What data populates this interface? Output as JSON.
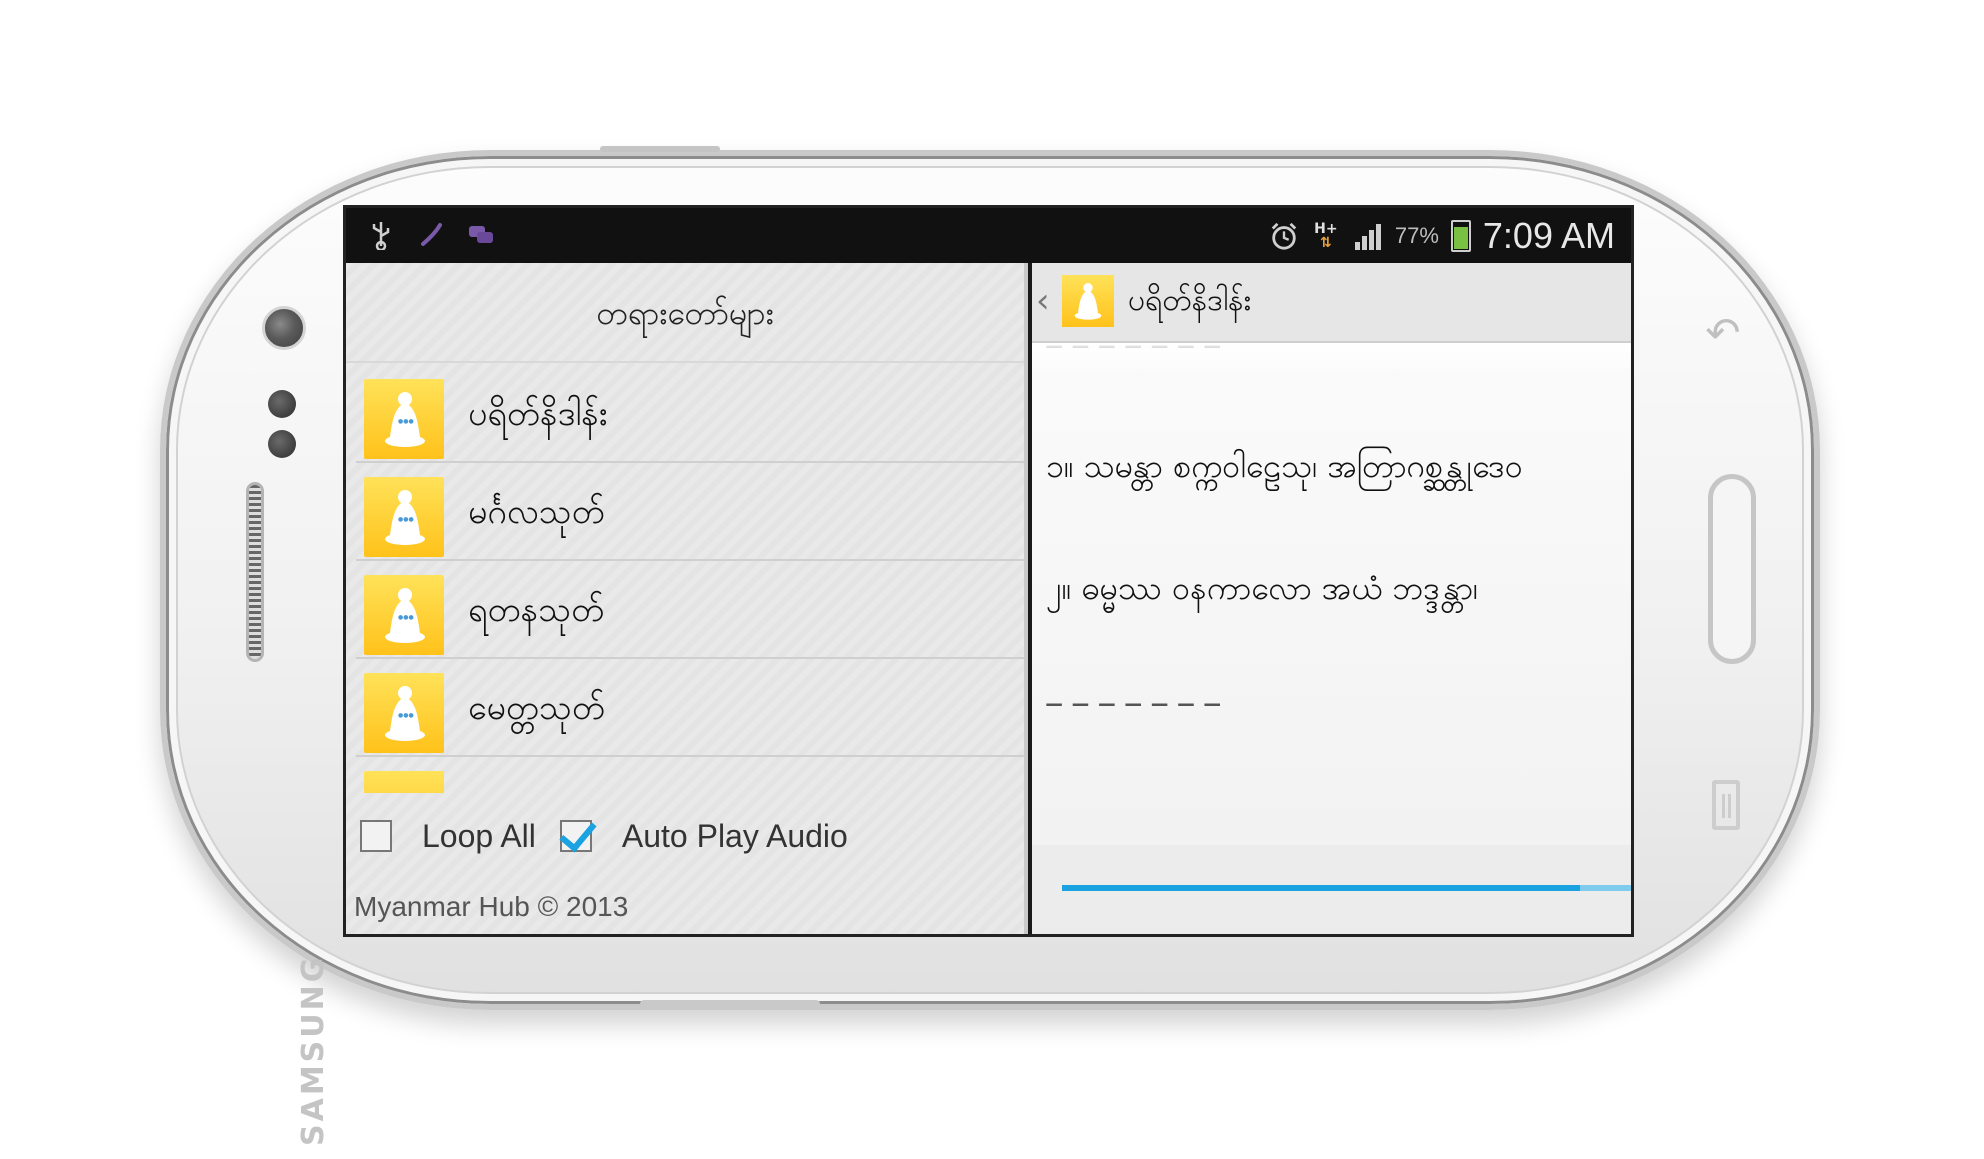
{
  "device": {
    "brand": "SAMSUNG"
  },
  "statusbar": {
    "icons_left": [
      "usb-icon",
      "phone-call-icon",
      "chat-icon"
    ],
    "network_type": "H+",
    "battery_percent": "77%",
    "battery_level": 0.77,
    "time": "7:09 AM"
  },
  "left_pane": {
    "title": "တရားတော်များ",
    "items": [
      {
        "label": "ပရိတ်နိဒါန်း",
        "icon": "buddha-icon"
      },
      {
        "label": "မင်္ဂလသုတ်",
        "icon": "buddha-icon"
      },
      {
        "label": "ရတနသုတ်",
        "icon": "buddha-icon"
      },
      {
        "label": "မေတ္တသုတ်",
        "icon": "buddha-icon"
      }
    ],
    "loop_all_label": "Loop All",
    "loop_all_checked": false,
    "auto_play_label": "Auto Play Audio",
    "auto_play_checked": true,
    "footer": "Myanmar Hub © 2013"
  },
  "right_pane": {
    "title": "ပရိတ်နိဒါန်း",
    "verses": [
      "၁။ သမန္တာ စက္ကဝါဠေသု၊ အတြာဂစ္ဆန္တုဒေဝ",
      "၂။ ဓမ္မဿ ဝနကာလော အယံ ဘဒ္ဒန္တာ၊"
    ],
    "progress": 0.9
  },
  "colors": {
    "accent": "#1aa3e0",
    "icon_yellow": "#ffc21a",
    "statusbar": "#111111"
  }
}
